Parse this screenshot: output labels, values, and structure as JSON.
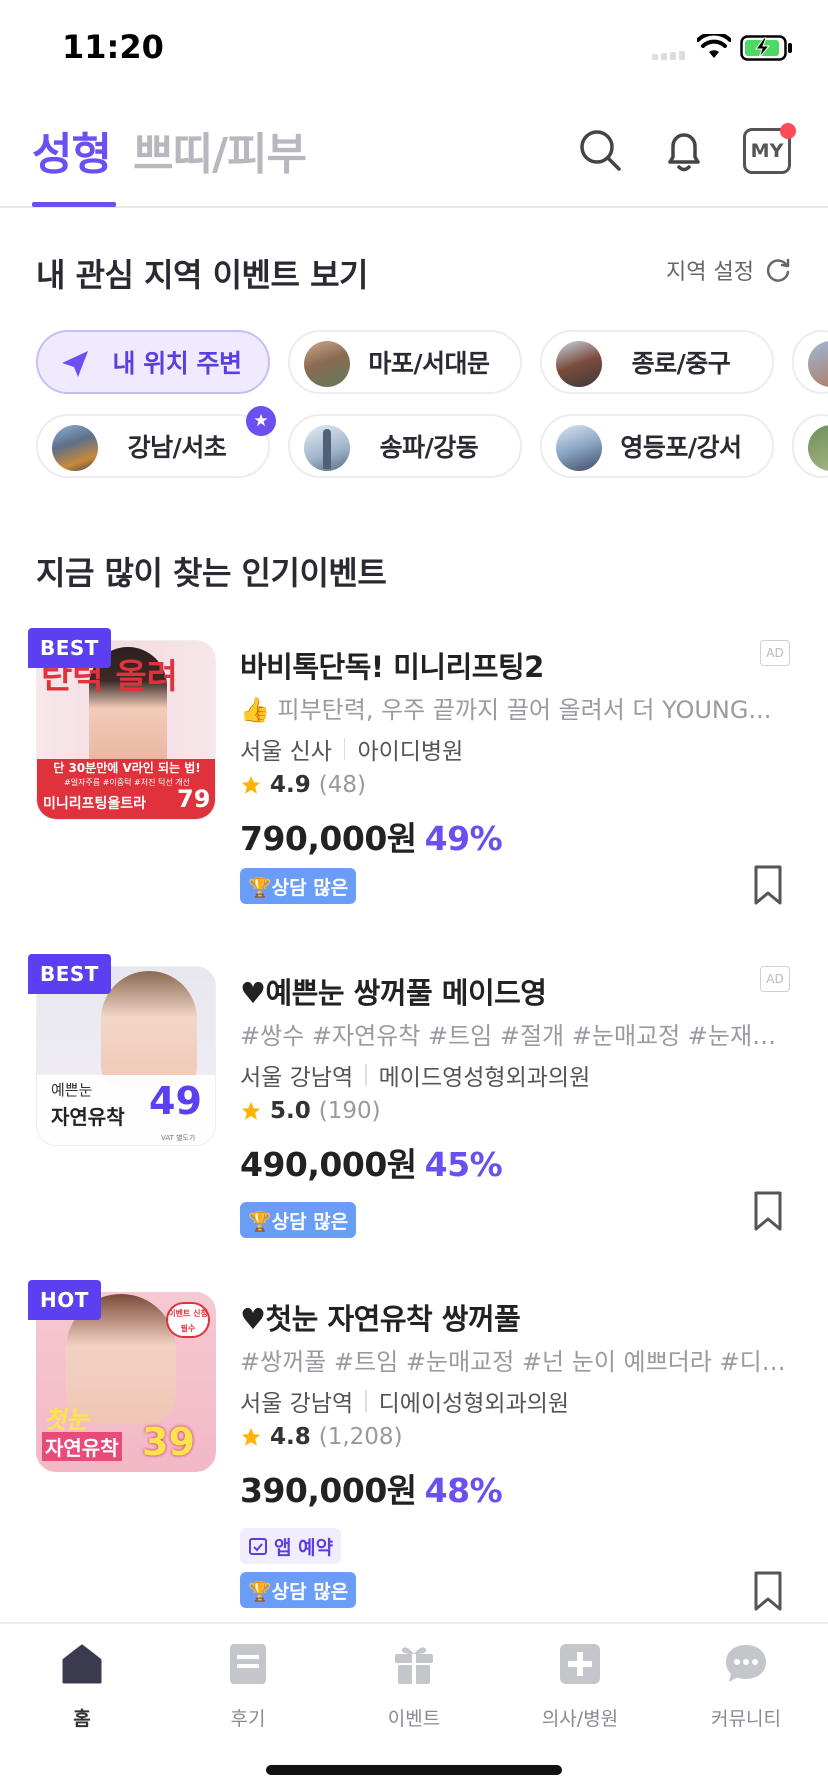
{
  "status_bar": {
    "time": "11:20"
  },
  "header": {
    "tab_active": "성형",
    "tab_inactive": "쁘띠/피부",
    "my_label": "MY"
  },
  "region": {
    "title": "내 관심 지역 이벤트 보기",
    "setting_label": "지역 설정",
    "chips_row1": [
      "내 위치 주변",
      "마포/서대문",
      "종로/중구"
    ],
    "chips_row2": [
      "강남/서초",
      "송파/강동",
      "영등포/강서"
    ]
  },
  "popular": {
    "title": "지금 많이 찾는 인기이벤트",
    "events": [
      {
        "tag": "BEST",
        "title": "바비톡단독! 미니리프팅2",
        "ad": "AD",
        "desc": "👍 피부탄력, 우주 끝까지 끌어 올려서 더 YOUNG...",
        "location": "서울 신사",
        "clinic": "아이디병원",
        "rating": "4.9",
        "review_count": "(48)",
        "price": "790,000원",
        "discount": "49%",
        "badge_consult": "🏆상담 많은",
        "img_text_top": "탄력 올려",
        "img_text_mid": "단 30분만에 V라인 되는 법!",
        "img_text_small": "#얼자주름 #이중턱 #처진 턱선 개선",
        "img_text_bottom": "미니리프팅울트라",
        "img_price": "79"
      },
      {
        "tag": "BEST",
        "title": "♥예쁜눈 쌍꺼풀 메이드영",
        "ad": "AD",
        "desc": "#쌍수 #자연유착 #트임 #절개 #눈매교정 #눈재수…",
        "location": "서울 강남역",
        "clinic": "메이드영성형외과의원",
        "rating": "5.0",
        "review_count": "(190)",
        "price": "490,000원",
        "discount": "45%",
        "badge_consult": "🏆상담 많은",
        "img_text_top": "예쁜눈",
        "img_text_bottom": "자연유착",
        "img_price": "49",
        "img_vat": "VAT 별도가"
      },
      {
        "tag": "HOT",
        "title": "♥첫눈 자연유착 쌍꺼풀",
        "desc": "#쌍꺼풀 #트임 #눈매교정 #넌 눈이 예쁘더라 #디…",
        "location": "서울 강남역",
        "clinic": "디에이성형외과의원",
        "rating": "4.8",
        "review_count": "(1,208)",
        "price": "390,000원",
        "discount": "48%",
        "badge_app": "앱 예약",
        "badge_consult": "🏆상담 많은",
        "img_text_top": "첫눈",
        "img_text_bottom": "자연유착",
        "img_price": "39",
        "img_sticker": "이벤트 신청필수"
      }
    ]
  },
  "bottom_nav": {
    "items": [
      "홈",
      "후기",
      "이벤트",
      "의사/병원",
      "커뮤니티"
    ]
  },
  "colors": {
    "accent": "#6b4ff0",
    "tag_bg": "#5b3ff0",
    "consult_badge": "#6a9df8",
    "star": "#ffb300"
  }
}
